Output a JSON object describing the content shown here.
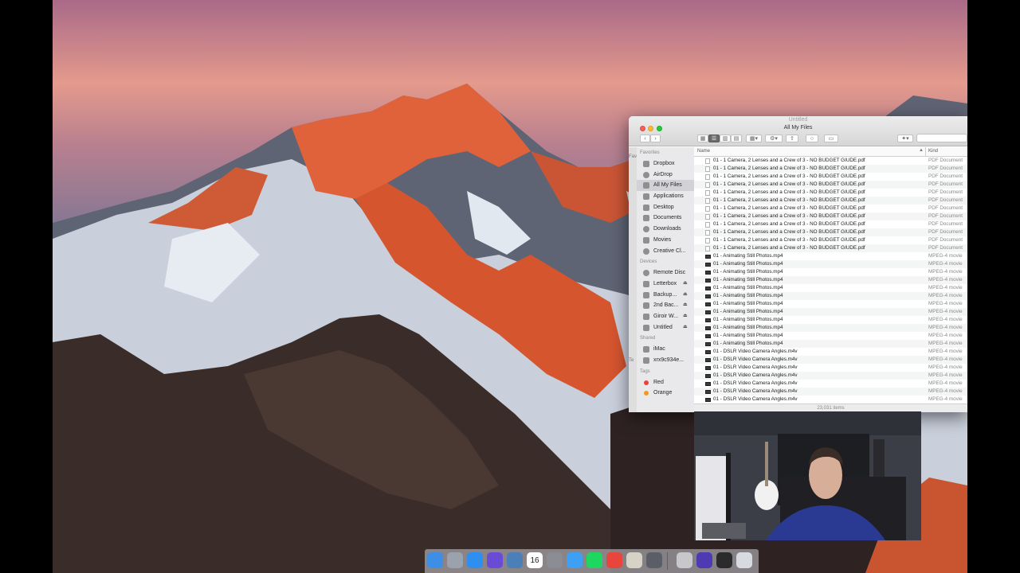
{
  "finder": {
    "window_title": "All My Files",
    "background_window_title": "Untitled",
    "sidebar_edge_labels": [
      "Favo",
      "Te"
    ],
    "sidebar": {
      "favorites_header": "Favorites",
      "favorites": [
        {
          "label": "Dropbox",
          "icon": "dropbox-icon"
        },
        {
          "label": "AirDrop",
          "icon": "airdrop-icon"
        },
        {
          "label": "All My Files",
          "icon": "all-my-files-icon",
          "selected": true
        },
        {
          "label": "Applications",
          "icon": "applications-icon"
        },
        {
          "label": "Desktop",
          "icon": "desktop-icon"
        },
        {
          "label": "Documents",
          "icon": "documents-icon"
        },
        {
          "label": "Downloads",
          "icon": "downloads-icon"
        },
        {
          "label": "Movies",
          "icon": "movies-icon"
        },
        {
          "label": "Creative Cl...",
          "icon": "creative-cloud-icon"
        }
      ],
      "devices_header": "Devices",
      "devices": [
        {
          "label": "Remote Disc",
          "icon": "remote-disc-icon"
        },
        {
          "label": "Letterbox",
          "icon": "drive-icon",
          "eject": "⏏"
        },
        {
          "label": "Backup...",
          "icon": "drive-icon",
          "eject": "⏏"
        },
        {
          "label": "2nd Bac...",
          "icon": "drive-icon",
          "eject": "⏏"
        },
        {
          "label": "Giroir W...",
          "icon": "drive-icon",
          "eject": "⏏"
        },
        {
          "label": "Untitled",
          "icon": "drive-icon",
          "eject": "⏏"
        }
      ],
      "shared_header": "Shared",
      "shared": [
        {
          "label": "iMac",
          "icon": "imac-icon"
        },
        {
          "label": "xrx9c934e...",
          "icon": "printer-icon"
        }
      ],
      "tags_header": "Tags",
      "tags": [
        {
          "label": "Red",
          "color": "#ef4040"
        },
        {
          "label": "Orange",
          "color": "#f39a1c"
        }
      ]
    },
    "columns": {
      "name": "Name",
      "kind": "Kind",
      "sort_indicator": "▲"
    },
    "rows": [
      {
        "name": "01 - 1 Camera, 2 Lenses and a Crew of 3 - NO BUDGET GIUDE.pdf",
        "kind": "PDF Document",
        "icon": "pdf-file-icon"
      },
      {
        "name": "01 - 1 Camera, 2 Lenses and a Crew of 3 - NO BUDGET GIUDE.pdf",
        "kind": "PDF Document",
        "icon": "pdf-file-icon"
      },
      {
        "name": "01 - 1 Camera, 2 Lenses and a Crew of 3 - NO BUDGET GIUDE.pdf",
        "kind": "PDF Document",
        "icon": "pdf-file-icon"
      },
      {
        "name": "01 - 1 Camera, 2 Lenses and a Crew of 3 - NO BUDGET GIUDE.pdf",
        "kind": "PDF Document",
        "icon": "pdf-file-icon"
      },
      {
        "name": "01 - 1 Camera, 2 Lenses and a Crew of 3 - NO BUDGET GIUDE.pdf",
        "kind": "PDF Document",
        "icon": "pdf-file-icon"
      },
      {
        "name": "01 - 1 Camera, 2 Lenses and a Crew of 3 - NO BUDGET GIUDE.pdf",
        "kind": "PDF Document",
        "icon": "pdf-file-icon"
      },
      {
        "name": "01 - 1 Camera, 2 Lenses and a Crew of 3 - NO BUDGET GIUDE.pdf",
        "kind": "PDF Document",
        "icon": "pdf-file-icon"
      },
      {
        "name": "01 - 1 Camera, 2 Lenses and a Crew of 3 - NO BUDGET GIUDE.pdf",
        "kind": "PDF Document",
        "icon": "pdf-file-icon"
      },
      {
        "name": "01 - 1 Camera, 2 Lenses and a Crew of 3 - NO BUDGET GIUDE.pdf",
        "kind": "PDF Document",
        "icon": "pdf-file-icon"
      },
      {
        "name": "01 - 1 Camera, 2 Lenses and a Crew of 3 - NO BUDGET GIUDE.pdf",
        "kind": "PDF Document",
        "icon": "pdf-file-icon"
      },
      {
        "name": "01 - 1 Camera, 2 Lenses and a Crew of 3 - NO BUDGET GIUDE.pdf",
        "kind": "PDF Document",
        "icon": "pdf-file-icon"
      },
      {
        "name": "01 - 1 Camera, 2 Lenses and a Crew of 3 - NO BUDGET GIUDE.pdf",
        "kind": "PDF Document",
        "icon": "pdf-file-icon"
      },
      {
        "name": "01 - Animating Still Photos.mp4",
        "kind": "MPEG-4 movie",
        "icon": "movie-file-icon"
      },
      {
        "name": "01 - Animating Still Photos.mp4",
        "kind": "MPEG-4 movie",
        "icon": "movie-file-icon"
      },
      {
        "name": "01 - Animating Still Photos.mp4",
        "kind": "MPEG-4 movie",
        "icon": "movie-file-icon"
      },
      {
        "name": "01 - Animating Still Photos.mp4",
        "kind": "MPEG-4 movie",
        "icon": "movie-file-icon"
      },
      {
        "name": "01 - Animating Still Photos.mp4",
        "kind": "MPEG-4 movie",
        "icon": "movie-file-icon"
      },
      {
        "name": "01 - Animating Still Photos.mp4",
        "kind": "MPEG-4 movie",
        "icon": "movie-file-icon"
      },
      {
        "name": "01 - Animating Still Photos.mp4",
        "kind": "MPEG-4 movie",
        "icon": "movie-file-icon"
      },
      {
        "name": "01 - Animating Still Photos.mp4",
        "kind": "MPEG-4 movie",
        "icon": "movie-file-icon"
      },
      {
        "name": "01 - Animating Still Photos.mp4",
        "kind": "MPEG-4 movie",
        "icon": "movie-file-icon"
      },
      {
        "name": "01 - Animating Still Photos.mp4",
        "kind": "MPEG-4 movie",
        "icon": "movie-file-icon"
      },
      {
        "name": "01 - Animating Still Photos.mp4",
        "kind": "MPEG-4 movie",
        "icon": "movie-file-icon"
      },
      {
        "name": "01 - Animating Still Photos.mp4",
        "kind": "MPEG-4 movie",
        "icon": "movie-file-icon"
      },
      {
        "name": "01 - DSLR Video Camera Angles.m4v",
        "kind": "MPEG-4 movie",
        "icon": "movie-file-icon"
      },
      {
        "name": "01 - DSLR Video Camera Angles.m4v",
        "kind": "MPEG-4 movie",
        "icon": "movie-file-icon"
      },
      {
        "name": "01 - DSLR Video Camera Angles.m4v",
        "kind": "MPEG-4 movie",
        "icon": "movie-file-icon"
      },
      {
        "name": "01 - DSLR Video Camera Angles.m4v",
        "kind": "MPEG-4 movie",
        "icon": "movie-file-icon"
      },
      {
        "name": "01 - DSLR Video Camera Angles.m4v",
        "kind": "MPEG-4 movie",
        "icon": "movie-file-icon"
      },
      {
        "name": "01 - DSLR Video Camera Angles.m4v",
        "kind": "MPEG-4 movie",
        "icon": "movie-file-icon"
      },
      {
        "name": "01 - DSLR Video Camera Angles.m4v",
        "kind": "MPEG-4 movie",
        "icon": "movie-file-icon"
      }
    ],
    "status_text": "23,031 items",
    "toolbar": {
      "back": "‹",
      "forward": "›",
      "action": "⚙▾",
      "dropbox": "▾"
    }
  },
  "dock": {
    "items": [
      {
        "name": "finder-icon",
        "color": "#3d8fe6"
      },
      {
        "name": "launchpad-icon",
        "color": "#9aa3ad"
      },
      {
        "name": "safari-icon",
        "color": "#2f8ff0"
      },
      {
        "name": "siri-icon",
        "color": "#6a4bd6"
      },
      {
        "name": "preview-icon",
        "color": "#4a7fb8"
      },
      {
        "name": "calendar-icon",
        "color": "#ffffff",
        "label": "16"
      },
      {
        "name": "system-preferences-icon",
        "color": "#8a8d93"
      },
      {
        "name": "messages-icon",
        "color": "#3ea0f5"
      },
      {
        "name": "spotify-icon",
        "color": "#1ed760"
      },
      {
        "name": "chrome-icon",
        "color": "#e8453c"
      },
      {
        "name": "script-editor-icon",
        "color": "#d6d2c6"
      },
      {
        "name": "davinci-icon",
        "color": "#5a5e66"
      },
      {
        "name": "music-icon",
        "color": "#c8c8cc"
      },
      {
        "name": "imovie-stars-icon",
        "color": "#4e3ab3"
      },
      {
        "name": "photo-viewer-icon",
        "color": "#2b2b2b"
      },
      {
        "name": "trash-icon",
        "color": "#d7dbe0"
      }
    ]
  },
  "colors": {
    "sidebar_bg": "#e9e9ec",
    "selected_bg": "#d2d2d6",
    "kind_text": "#8a8a8a"
  }
}
